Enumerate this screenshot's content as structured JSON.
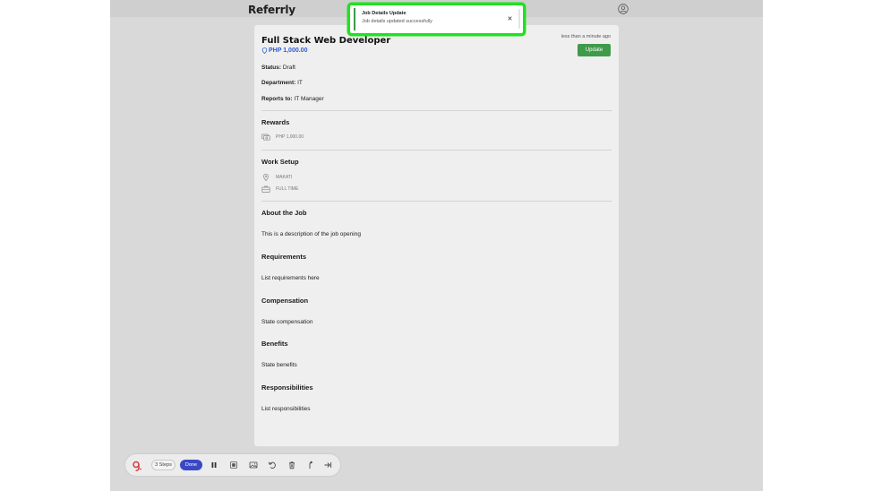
{
  "app": {
    "brand": "Referrly"
  },
  "toast": {
    "title": "Job Details Update",
    "message": "Job details updated successfully"
  },
  "job": {
    "title": "Full Stack Web Developer",
    "pay": "PHP 1,000.00",
    "timestamp": "less than a minute ago",
    "update_label": "Update",
    "status_label": "Status:",
    "status_value": "Draft",
    "department_label": "Department:",
    "department_value": "IT",
    "reports_label": "Reports to:",
    "reports_value": "IT Manager"
  },
  "sections": {
    "rewards": {
      "heading": "Rewards",
      "value": "PHP 1,000.00"
    },
    "work_setup": {
      "heading": "Work Setup",
      "location": "MAKATI",
      "type": "FULL TIME"
    },
    "about": {
      "heading": "About the Job",
      "text": "This is a description of the job opening"
    },
    "requirements": {
      "heading": "Requirements",
      "text": "List requirements here"
    },
    "compensation": {
      "heading": "Compensation",
      "text": "State compensation"
    },
    "benefits": {
      "heading": "Benefits",
      "text": "State benefits"
    },
    "responsibilities": {
      "heading": "Responsibilities",
      "text": "List responsibilities"
    }
  },
  "recorder": {
    "steps_label": "3 Steps",
    "done_label": "Done"
  },
  "colors": {
    "accent_green": "#3f9a4a",
    "highlight_green": "#22e022",
    "link_blue": "#2f5bd8",
    "done_blue": "#3a48c4",
    "logo_red": "#d23b3b"
  }
}
